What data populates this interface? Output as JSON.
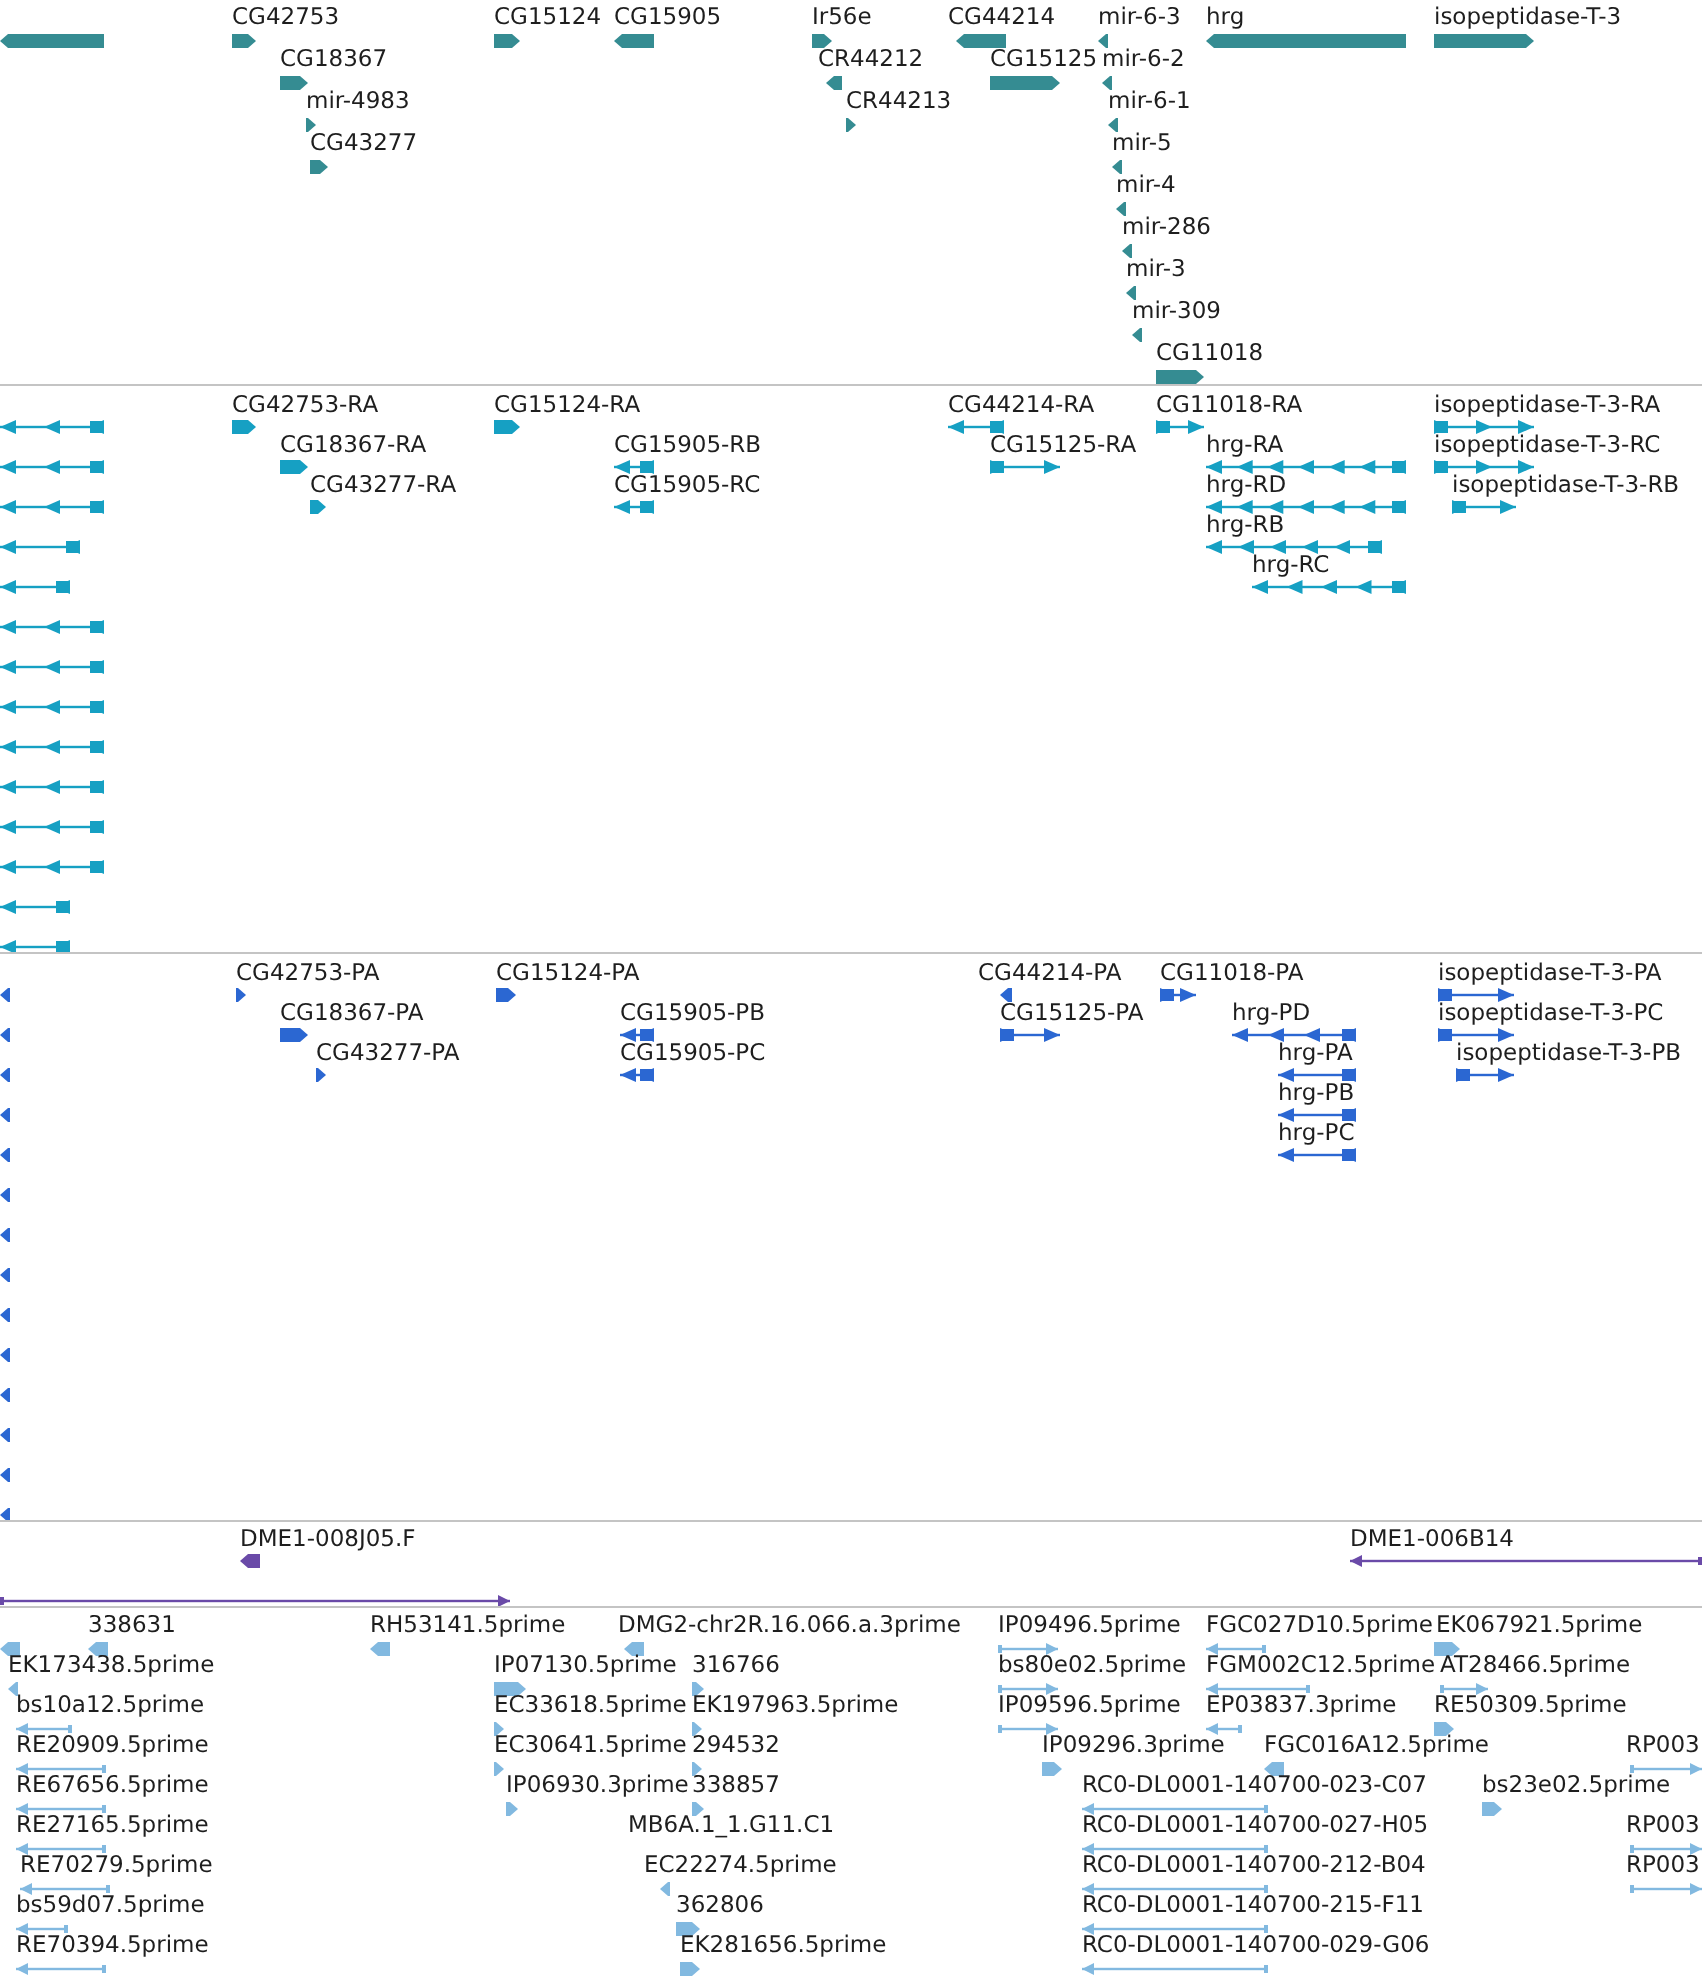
{
  "tracks": [
    {
      "kind": "gene",
      "features": [
        {
          "reverse": true
        },
        {
          "label": "CG42753",
          "reverse": false
        },
        {
          "label": "CG18367",
          "reverse": false
        },
        {
          "label": "mir-4983",
          "reverse": false
        },
        {
          "label": "CG43277",
          "reverse": false
        },
        {
          "label": "CG15124",
          "reverse": false
        },
        {
          "label": "CG15905",
          "reverse": true
        },
        {
          "label": "Ir56e",
          "reverse": false
        },
        {
          "label": "CR44212",
          "reverse": true
        },
        {
          "label": "CR44213",
          "reverse": false
        },
        {
          "label": "CG44214",
          "reverse": true
        },
        {
          "label": "CG15125",
          "reverse": false
        },
        {
          "label": "mir-6-3",
          "reverse": true
        },
        {
          "label": "hrg",
          "reverse": true
        },
        {
          "label": "mir-6-2",
          "reverse": true
        },
        {
          "label": "mir-6-1",
          "reverse": true
        },
        {
          "label": "mir-5",
          "reverse": true
        },
        {
          "label": "mir-4",
          "reverse": true
        },
        {
          "label": "mir-286",
          "reverse": true
        },
        {
          "label": "mir-3",
          "reverse": true
        },
        {
          "label": "mir-309",
          "reverse": true
        },
        {
          "label": "CG11018",
          "reverse": false
        },
        {
          "label": "isopeptidase-T-3",
          "reverse": false
        }
      ]
    },
    {
      "kind": "transcript",
      "features": [
        {
          "reverse": true
        },
        {
          "reverse": true
        },
        {
          "reverse": true
        },
        {
          "reverse": true
        },
        {
          "reverse": true
        },
        {
          "reverse": true
        },
        {
          "reverse": true
        },
        {
          "reverse": true
        },
        {
          "reverse": true
        },
        {
          "reverse": true
        },
        {
          "reverse": true
        },
        {
          "reverse": true
        },
        {
          "reverse": true
        },
        {
          "reverse": true
        },
        {
          "label": "CG42753-RA",
          "reverse": false
        },
        {
          "label": "CG18367-RA",
          "reverse": false
        },
        {
          "label": "CG43277-RA",
          "reverse": false
        },
        {
          "label": "CG15124-RA",
          "reverse": false
        },
        {
          "label": "CG15905-RB",
          "reverse": true
        },
        {
          "label": "CG15905-RC",
          "reverse": true
        },
        {
          "label": "CG44214-RA",
          "reverse": true
        },
        {
          "label": "CG15125-RA",
          "reverse": false
        },
        {
          "label": "CG11018-RA",
          "reverse": false
        },
        {
          "label": "hrg-RA",
          "reverse": true
        },
        {
          "label": "hrg-RD",
          "reverse": true
        },
        {
          "label": "hrg-RB",
          "reverse": true
        },
        {
          "label": "hrg-RC",
          "reverse": true
        },
        {
          "label": "isopeptidase-T-3-RA",
          "reverse": false
        },
        {
          "label": "isopeptidase-T-3-RC",
          "reverse": false
        },
        {
          "label": "isopeptidase-T-3-RB",
          "reverse": false
        }
      ]
    },
    {
      "kind": "protein",
      "features": [
        {
          "reverse": true
        },
        {
          "reverse": true
        },
        {
          "reverse": true
        },
        {
          "reverse": true
        },
        {
          "reverse": true
        },
        {
          "reverse": true
        },
        {
          "reverse": true
        },
        {
          "reverse": true
        },
        {
          "reverse": true
        },
        {
          "reverse": true
        },
        {
          "reverse": true
        },
        {
          "reverse": true
        },
        {
          "reverse": true
        },
        {
          "reverse": true
        },
        {
          "label": "CG42753-PA",
          "reverse": false
        },
        {
          "label": "CG18367-PA",
          "reverse": false
        },
        {
          "label": "CG43277-PA",
          "reverse": false
        },
        {
          "label": "CG15124-PA",
          "reverse": false
        },
        {
          "label": "CG15905-PB",
          "reverse": true
        },
        {
          "label": "CG15905-PC",
          "reverse": true
        },
        {
          "label": "CG44214-PA",
          "reverse": true
        },
        {
          "label": "CG15125-PA",
          "reverse": false
        },
        {
          "label": "CG11018-PA",
          "reverse": false
        },
        {
          "label": "hrg-PD",
          "reverse": true
        },
        {
          "label": "hrg-PA",
          "reverse": true
        },
        {
          "label": "hrg-PB",
          "reverse": true
        },
        {
          "label": "hrg-PC",
          "reverse": true
        },
        {
          "label": "isopeptidase-T-3-PA",
          "reverse": false
        },
        {
          "label": "isopeptidase-T-3-PC",
          "reverse": false
        },
        {
          "label": "isopeptidase-T-3-PB",
          "reverse": false
        }
      ]
    },
    {
      "kind": "clone",
      "features": [
        {
          "label": "DME1-008J05.F",
          "reverse": true
        },
        {
          "reverse": false
        },
        {
          "label": "DME1-006B14",
          "reverse": true
        }
      ]
    },
    {
      "kind": "est",
      "features": [
        {
          "reverse": true
        },
        {
          "label": "338631",
          "reverse": true
        },
        {
          "label": "RH53141.5prime",
          "reverse": true
        },
        {
          "label": "DMG2-chr2R.16.066.a.3prime",
          "reverse": true
        },
        {
          "label": "IP09496.5prime",
          "reverse": false
        },
        {
          "label": "FGC027D10.5prime",
          "reverse": true
        },
        {
          "label": "EK067921.5prime",
          "reverse": false
        },
        {
          "label": "EK173438.5prime",
          "reverse": true
        },
        {
          "label": "IP07130.5prime",
          "reverse": false
        },
        {
          "label": "316766",
          "reverse": false
        },
        {
          "label": "bs80e02.5prime",
          "reverse": false
        },
        {
          "label": "FGM002C12.5prime",
          "reverse": true
        },
        {
          "label": "AT28466.5prime",
          "reverse": false
        },
        {
          "label": "bs10a12.5prime",
          "reverse": true
        },
        {
          "label": "EC33618.5prime",
          "reverse": false
        },
        {
          "label": "EK197963.5prime",
          "reverse": false
        },
        {
          "label": "IP09596.5prime",
          "reverse": false
        },
        {
          "label": "EP03837.3prime",
          "reverse": true
        },
        {
          "label": "RE50309.5prime",
          "reverse": false
        },
        {
          "label": "RE20909.5prime",
          "reverse": true
        },
        {
          "label": "EC30641.5prime",
          "reverse": false
        },
        {
          "label": "294532",
          "reverse": false
        },
        {
          "label": "IP09296.3prime",
          "reverse": false
        },
        {
          "label": "FGC016A12.5prime",
          "reverse": true
        },
        {
          "label": "RP003",
          "reverse": false
        },
        {
          "label": "RE67656.5prime",
          "reverse": true
        },
        {
          "label": "IP06930.3prime",
          "reverse": false
        },
        {
          "label": "338857",
          "reverse": false
        },
        {
          "label": "RC0-DL0001-140700-023-C07",
          "reverse": true
        },
        {
          "label": "bs23e02.5prime",
          "reverse": false
        },
        {
          "label": "RE27165.5prime",
          "reverse": true
        },
        {
          "label": "MB6A.1_1.G11.C1"
        },
        {
          "label": "RC0-DL0001-140700-027-H05",
          "reverse": true
        },
        {
          "label": "RP003",
          "reverse": false
        },
        {
          "label": "RE70279.5prime",
          "reverse": true
        },
        {
          "label": "EC22274.5prime",
          "reverse": true
        },
        {
          "label": "RC0-DL0001-140700-212-B04",
          "reverse": true
        },
        {
          "label": "RP003",
          "reverse": false
        },
        {
          "label": "bs59d07.5prime",
          "reverse": true
        },
        {
          "label": "362806",
          "reverse": false
        },
        {
          "label": "RC0-DL0001-140700-215-F11",
          "reverse": true
        },
        {
          "label": "RE70394.5prime",
          "reverse": true
        },
        {
          "label": "EK281656.5prime",
          "reverse": false
        },
        {
          "label": "RC0-DL0001-140700-029-G06",
          "reverse": true
        }
      ]
    }
  ]
}
